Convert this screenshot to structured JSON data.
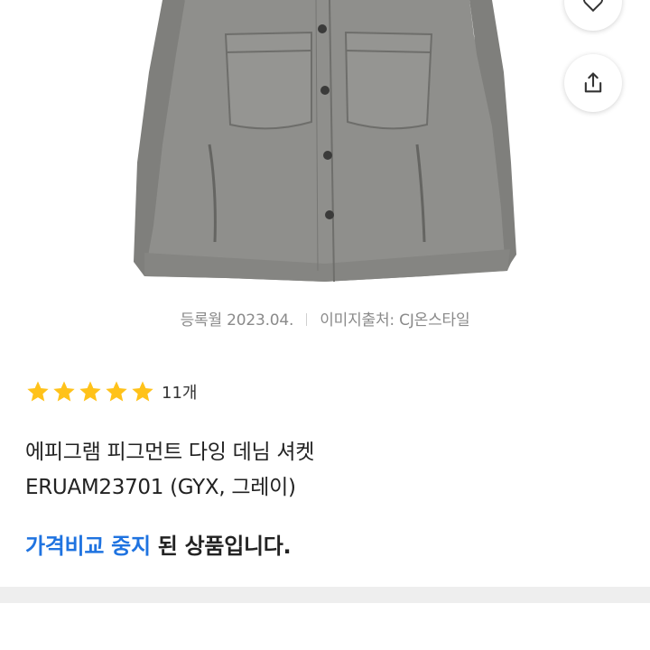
{
  "image_meta": {
    "registered": "등록월 2023.04.",
    "source": "이미지출처: CJ온스타일"
  },
  "actions": {
    "wish_icon": "heart-icon",
    "share_icon": "share-icon"
  },
  "rating": {
    "stars": 5,
    "count_label": "11개",
    "star_color": "#FFC21A"
  },
  "product": {
    "title_line1": "에피그램 피그먼트 다잉 데님 셔켓",
    "title_line2": "ERUAM23701 (GYX, 그레이)"
  },
  "notice": {
    "highlight": "가격비교 중지",
    "rest": " 된 상품입니다.",
    "highlight_color": "#1F73E0"
  },
  "product_image": {
    "jacket_color": "#8f8f8c"
  }
}
